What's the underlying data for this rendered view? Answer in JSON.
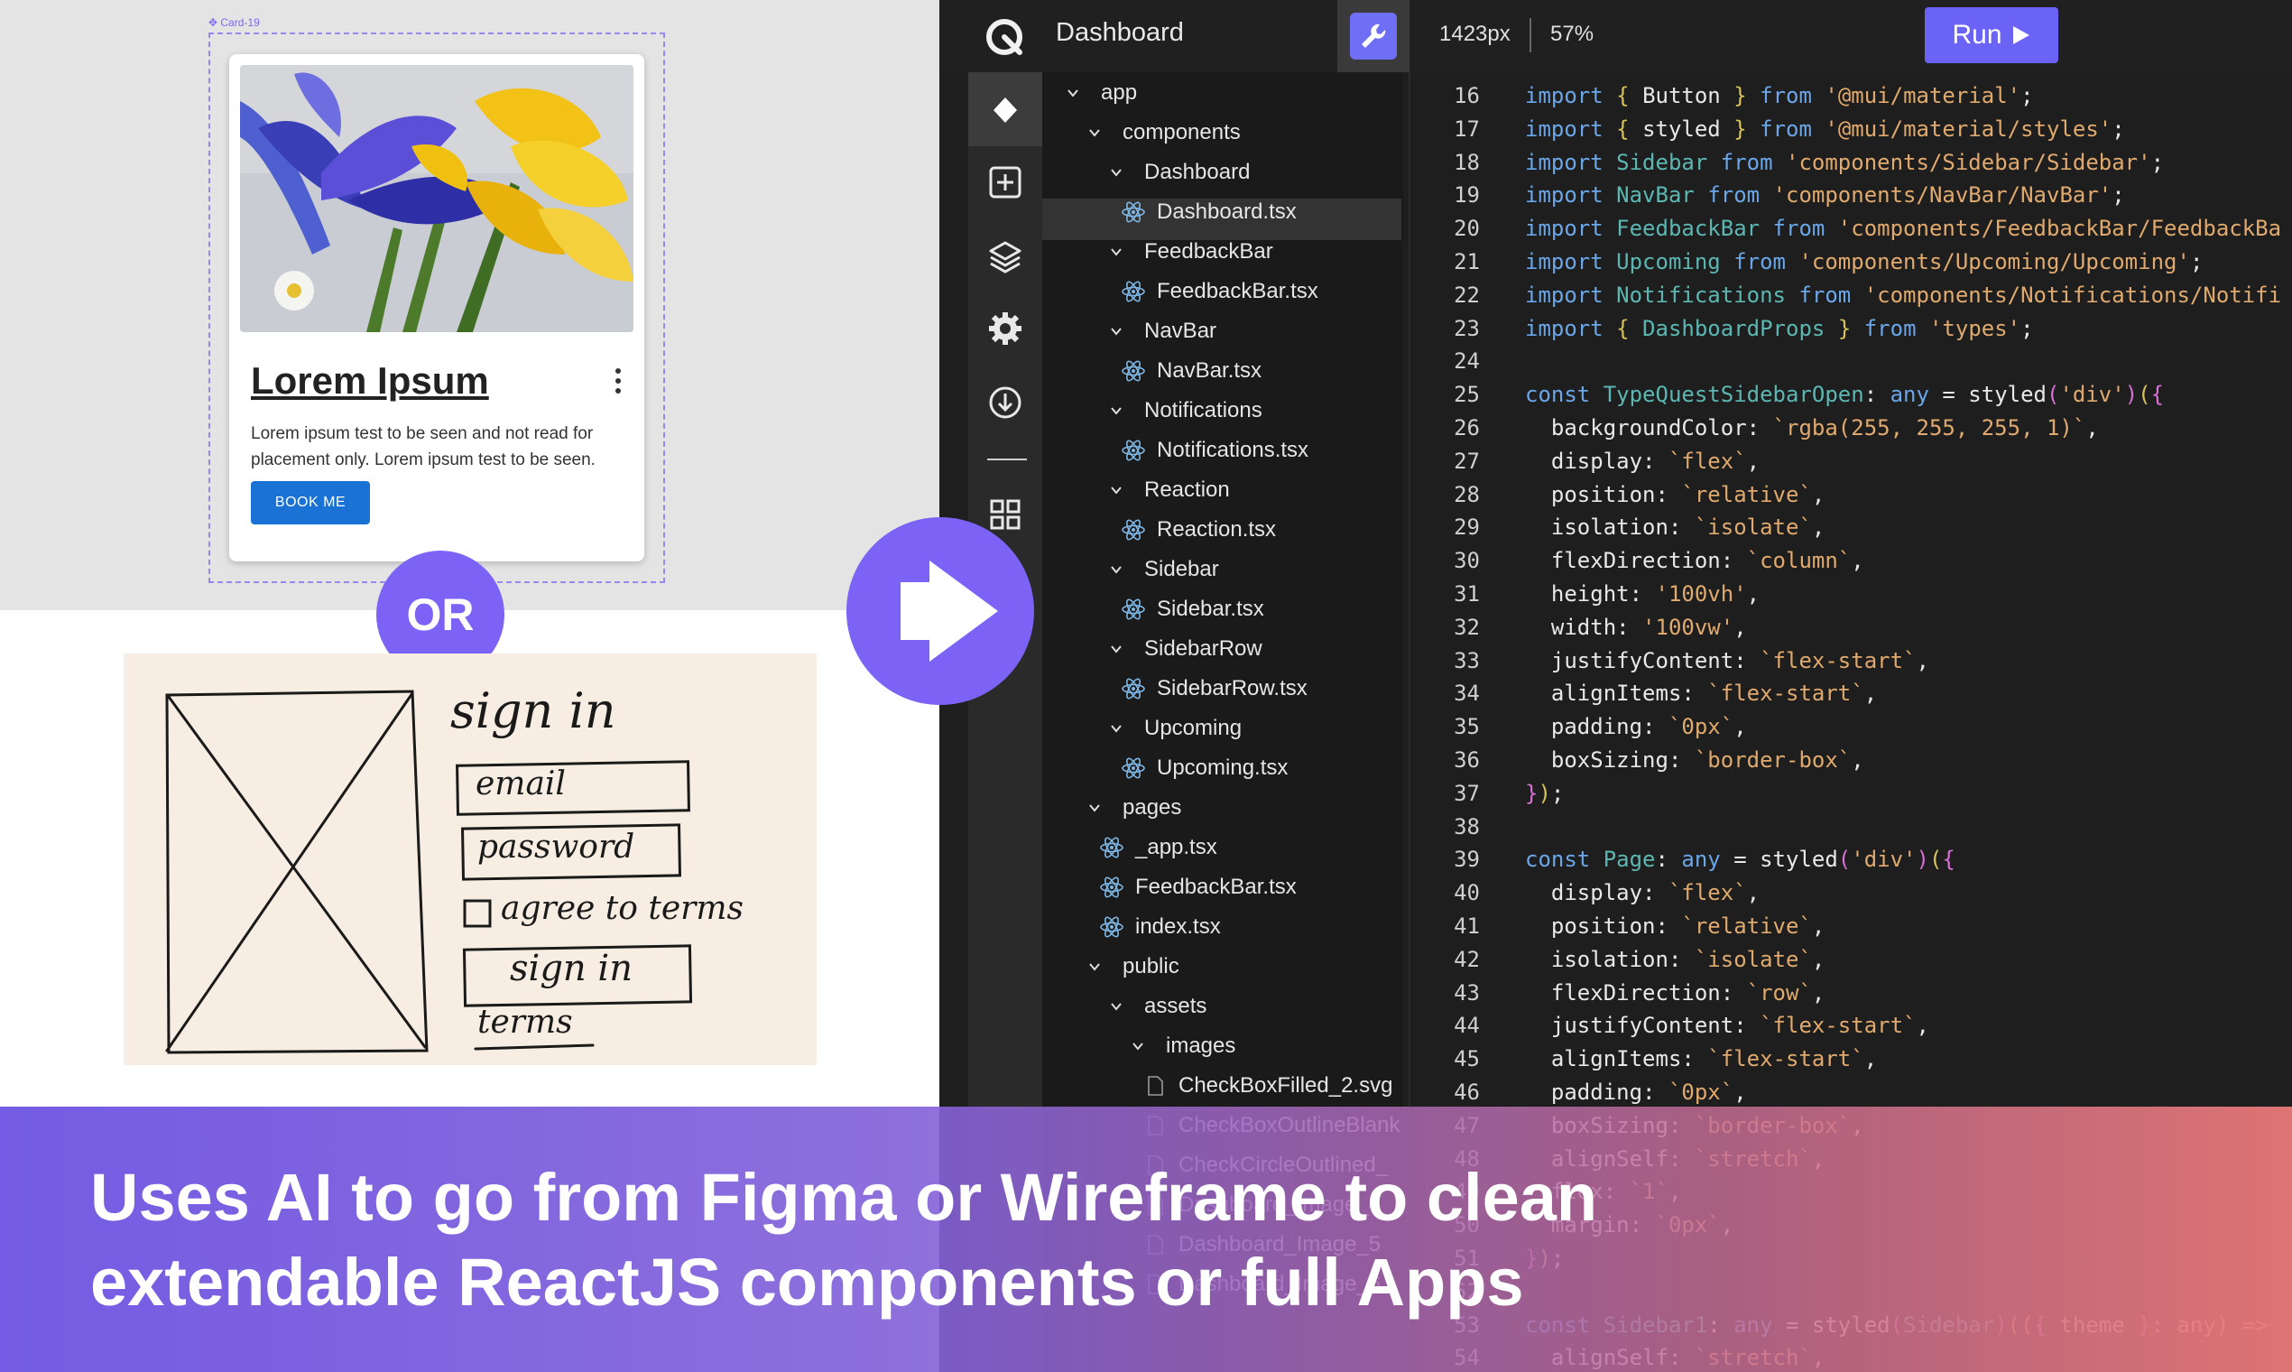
{
  "left": {
    "card_frame_label": "Card-19",
    "card": {
      "title": "Lorem Ipsum",
      "body": "Lorem ipsum test to be seen and not read for placement only. Lorem ipsum test to be seen.",
      "button_label": "BOOK ME"
    },
    "or_label": "OR",
    "wireframe": {
      "title": "sign in",
      "email_label": "email",
      "password_label": "password",
      "agree_label": "agree to terms",
      "sign_in_button": "sign in",
      "terms_link": "terms"
    }
  },
  "topbar": {
    "title": "Dashboard",
    "width_readout": "1423px",
    "zoom_readout": "57%",
    "run_label": "Run"
  },
  "tree": [
    {
      "label": "app",
      "kind": "folder",
      "depth": 0
    },
    {
      "label": "components",
      "kind": "folder",
      "depth": 1
    },
    {
      "label": "Dashboard",
      "kind": "folder",
      "depth": 2
    },
    {
      "label": "Dashboard.tsx",
      "kind": "file",
      "depth": 3,
      "selected": true
    },
    {
      "label": "FeedbackBar",
      "kind": "folder",
      "depth": 2
    },
    {
      "label": "FeedbackBar.tsx",
      "kind": "file",
      "depth": 3
    },
    {
      "label": "NavBar",
      "kind": "folder",
      "depth": 2
    },
    {
      "label": "NavBar.tsx",
      "kind": "file",
      "depth": 3
    },
    {
      "label": "Notifications",
      "kind": "folder",
      "depth": 2
    },
    {
      "label": "Notifications.tsx",
      "kind": "file",
      "depth": 3
    },
    {
      "label": "Reaction",
      "kind": "folder",
      "depth": 2
    },
    {
      "label": "Reaction.tsx",
      "kind": "file",
      "depth": 3
    },
    {
      "label": "Sidebar",
      "kind": "folder",
      "depth": 2
    },
    {
      "label": "Sidebar.tsx",
      "kind": "file",
      "depth": 3
    },
    {
      "label": "SidebarRow",
      "kind": "folder",
      "depth": 2
    },
    {
      "label": "SidebarRow.tsx",
      "kind": "file",
      "depth": 3
    },
    {
      "label": "Upcoming",
      "kind": "folder",
      "depth": 2
    },
    {
      "label": "Upcoming.tsx",
      "kind": "file",
      "depth": 3
    },
    {
      "label": "pages",
      "kind": "folder",
      "depth": 1
    },
    {
      "label": "_app.tsx",
      "kind": "file",
      "depth": 2
    },
    {
      "label": "FeedbackBar.tsx",
      "kind": "file",
      "depth": 2
    },
    {
      "label": "index.tsx",
      "kind": "file",
      "depth": 2
    },
    {
      "label": "public",
      "kind": "folder",
      "depth": 1
    },
    {
      "label": "assets",
      "kind": "folder",
      "depth": 2
    },
    {
      "label": "images",
      "kind": "folder",
      "depth": 3
    },
    {
      "label": "CheckBoxFilled_2.svg",
      "kind": "img",
      "depth": 4
    },
    {
      "label": "CheckBoxOutlineBlank",
      "kind": "img",
      "depth": 4
    },
    {
      "label": "CheckCircleOutlined_",
      "kind": "img",
      "depth": 4
    },
    {
      "label": "Dashboard_Image_4",
      "kind": "img",
      "depth": 4
    },
    {
      "label": "Dashboard_Image_5",
      "kind": "img",
      "depth": 4
    },
    {
      "label": "Dashboard_Image_6",
      "kind": "img",
      "depth": 4
    }
  ],
  "code": [
    {
      "n": "16",
      "t": [
        [
          "kw",
          "import "
        ],
        [
          "br",
          "{ "
        ],
        [
          "",
          "Button "
        ],
        [
          "br",
          "} "
        ],
        [
          "kw",
          "from "
        ],
        [
          "str",
          "'@mui/material'"
        ],
        [
          "",
          ";"
        ]
      ]
    },
    {
      "n": "17",
      "t": [
        [
          "kw",
          "import "
        ],
        [
          "br",
          "{ "
        ],
        [
          "",
          "styled "
        ],
        [
          "br",
          "} "
        ],
        [
          "kw",
          "from "
        ],
        [
          "str",
          "'@mui/material/styles'"
        ],
        [
          "",
          ";"
        ]
      ]
    },
    {
      "n": "18",
      "t": [
        [
          "kw",
          "import "
        ],
        [
          "ty",
          "Sidebar "
        ],
        [
          "kw",
          "from "
        ],
        [
          "str",
          "'components/Sidebar/Sidebar'"
        ],
        [
          "",
          ";"
        ]
      ]
    },
    {
      "n": "19",
      "t": [
        [
          "kw",
          "import "
        ],
        [
          "ty",
          "NavBar "
        ],
        [
          "kw",
          "from "
        ],
        [
          "str",
          "'components/NavBar/NavBar'"
        ],
        [
          "",
          ";"
        ]
      ]
    },
    {
      "n": "20",
      "t": [
        [
          "kw",
          "import "
        ],
        [
          "ty",
          "FeedbackBar "
        ],
        [
          "kw",
          "from "
        ],
        [
          "str",
          "'components/FeedbackBar/FeedbackBa"
        ]
      ]
    },
    {
      "n": "21",
      "t": [
        [
          "kw",
          "import "
        ],
        [
          "ty",
          "Upcoming "
        ],
        [
          "kw",
          "from "
        ],
        [
          "str",
          "'components/Upcoming/Upcoming'"
        ],
        [
          "",
          ";"
        ]
      ]
    },
    {
      "n": "22",
      "t": [
        [
          "kw",
          "import "
        ],
        [
          "ty",
          "Notifications "
        ],
        [
          "kw",
          "from "
        ],
        [
          "str",
          "'components/Notifications/Notifi"
        ]
      ]
    },
    {
      "n": "23",
      "t": [
        [
          "kw",
          "import "
        ],
        [
          "br",
          "{ "
        ],
        [
          "ty",
          "DashboardProps "
        ],
        [
          "br",
          "} "
        ],
        [
          "kw",
          "from "
        ],
        [
          "str",
          "'types'"
        ],
        [
          "",
          ";"
        ]
      ]
    },
    {
      "n": "24",
      "t": []
    },
    {
      "n": "25",
      "t": [
        [
          "kw",
          "const "
        ],
        [
          "ty",
          "TypeQuestSidebarOpen"
        ],
        [
          "",
          ": "
        ],
        [
          "kw",
          "any "
        ],
        [
          "",
          "= styled"
        ],
        [
          "br2",
          "("
        ],
        [
          "str",
          "'div'"
        ],
        [
          "br2",
          ")"
        ],
        [
          "br",
          "("
        ],
        [
          "br2",
          "{"
        ]
      ]
    },
    {
      "n": "26",
      "t": [
        [
          "",
          "  backgroundColor: "
        ],
        [
          "str",
          "`rgba(255, 255, 255, 1)`"
        ],
        [
          "",
          ","
        ]
      ]
    },
    {
      "n": "27",
      "t": [
        [
          "",
          "  display: "
        ],
        [
          "str",
          "`flex`"
        ],
        [
          "",
          ","
        ]
      ]
    },
    {
      "n": "28",
      "t": [
        [
          "",
          "  position: "
        ],
        [
          "str",
          "`relative`"
        ],
        [
          "",
          ","
        ]
      ]
    },
    {
      "n": "29",
      "t": [
        [
          "",
          "  isolation: "
        ],
        [
          "str",
          "`isolate`"
        ],
        [
          "",
          ","
        ]
      ]
    },
    {
      "n": "30",
      "t": [
        [
          "",
          "  flexDirection: "
        ],
        [
          "str",
          "`column`"
        ],
        [
          "",
          ","
        ]
      ]
    },
    {
      "n": "31",
      "t": [
        [
          "",
          "  height: "
        ],
        [
          "str",
          "'100vh'"
        ],
        [
          "",
          ","
        ]
      ]
    },
    {
      "n": "32",
      "t": [
        [
          "",
          "  width: "
        ],
        [
          "str",
          "'100vw'"
        ],
        [
          "",
          ","
        ]
      ]
    },
    {
      "n": "33",
      "t": [
        [
          "",
          "  justifyContent: "
        ],
        [
          "str",
          "`flex-start`"
        ],
        [
          "",
          ","
        ]
      ]
    },
    {
      "n": "34",
      "t": [
        [
          "",
          "  alignItems: "
        ],
        [
          "str",
          "`flex-start`"
        ],
        [
          "",
          ","
        ]
      ]
    },
    {
      "n": "35",
      "t": [
        [
          "",
          "  padding: "
        ],
        [
          "str",
          "`0px`"
        ],
        [
          "",
          ","
        ]
      ]
    },
    {
      "n": "36",
      "t": [
        [
          "",
          "  boxSizing: "
        ],
        [
          "str",
          "`border-box`"
        ],
        [
          "",
          ","
        ]
      ]
    },
    {
      "n": "37",
      "t": [
        [
          "br2",
          "}"
        ],
        [
          "br",
          ")"
        ],
        [
          "",
          ";"
        ]
      ]
    },
    {
      "n": "38",
      "t": []
    },
    {
      "n": "39",
      "t": [
        [
          "kw",
          "const "
        ],
        [
          "ty",
          "Page"
        ],
        [
          "",
          ": "
        ],
        [
          "kw",
          "any "
        ],
        [
          "",
          "= styled"
        ],
        [
          "br2",
          "("
        ],
        [
          "str",
          "'div'"
        ],
        [
          "br2",
          ")"
        ],
        [
          "br",
          "("
        ],
        [
          "br2",
          "{"
        ]
      ]
    },
    {
      "n": "40",
      "t": [
        [
          "",
          "  display: "
        ],
        [
          "str",
          "`flex`"
        ],
        [
          "",
          ","
        ]
      ]
    },
    {
      "n": "41",
      "t": [
        [
          "",
          "  position: "
        ],
        [
          "str",
          "`relative`"
        ],
        [
          "",
          ","
        ]
      ]
    },
    {
      "n": "42",
      "t": [
        [
          "",
          "  isolation: "
        ],
        [
          "str",
          "`isolate`"
        ],
        [
          "",
          ","
        ]
      ]
    },
    {
      "n": "43",
      "t": [
        [
          "",
          "  flexDirection: "
        ],
        [
          "str",
          "`row`"
        ],
        [
          "",
          ","
        ]
      ]
    },
    {
      "n": "44",
      "t": [
        [
          "",
          "  justifyContent: "
        ],
        [
          "str",
          "`flex-start`"
        ],
        [
          "",
          ","
        ]
      ]
    },
    {
      "n": "45",
      "t": [
        [
          "",
          "  alignItems: "
        ],
        [
          "str",
          "`flex-start`"
        ],
        [
          "",
          ","
        ]
      ]
    },
    {
      "n": "46",
      "t": [
        [
          "",
          "  padding: "
        ],
        [
          "str",
          "`0px`"
        ],
        [
          "",
          ","
        ]
      ]
    },
    {
      "n": "47",
      "t": [
        [
          "",
          "  boxSizing: "
        ],
        [
          "str",
          "`border-box`"
        ],
        [
          "",
          ","
        ]
      ]
    },
    {
      "n": "48",
      "t": [
        [
          "",
          "  alignSelf: "
        ],
        [
          "str",
          "`stretch`"
        ],
        [
          "",
          ","
        ]
      ]
    },
    {
      "n": "49",
      "t": [
        [
          "",
          "  flex: "
        ],
        [
          "str",
          "`1`"
        ],
        [
          "",
          ","
        ]
      ]
    },
    {
      "n": "50",
      "t": [
        [
          "",
          "  margin: "
        ],
        [
          "str",
          "`0px`"
        ],
        [
          "",
          ","
        ]
      ]
    },
    {
      "n": "51",
      "t": [
        [
          "br2",
          "}"
        ],
        [
          "br",
          ")"
        ],
        [
          "",
          ";"
        ]
      ]
    },
    {
      "n": "52",
      "t": []
    },
    {
      "n": "53",
      "t": [
        [
          "kw",
          "const "
        ],
        [
          "ty",
          "Sidebar1"
        ],
        [
          "",
          ": "
        ],
        [
          "kw",
          "any "
        ],
        [
          "",
          "= styled"
        ],
        [
          "br2",
          "("
        ],
        [
          "ty",
          "Sidebar"
        ],
        [
          "br2",
          ")"
        ],
        [
          "br",
          "(("
        ],
        [
          "br2",
          "{ "
        ],
        [
          "",
          "theme "
        ],
        [
          "br2",
          "}"
        ],
        [
          "",
          ": any) =>"
        ]
      ]
    },
    {
      "n": "54",
      "t": [
        [
          "",
          "  alignSelf: "
        ],
        [
          "str",
          "`stretch`"
        ],
        [
          "",
          ","
        ]
      ]
    }
  ],
  "banner": {
    "line1": "Uses AI to go from Figma or Wireframe to clean",
    "line2": "extendable ReactJS components or full Apps"
  },
  "colors": {
    "accent": "#7d63f5",
    "run_button": "#6b63f5",
    "book_button": "#1a73d4"
  },
  "icons": [
    "logo-icon",
    "wrench-icon",
    "play-icon",
    "select-tool-icon",
    "add-icon",
    "layers-icon",
    "gear-icon",
    "download-icon",
    "grid-icon",
    "react-file-icon",
    "image-file-icon",
    "chevron-down-icon",
    "more-vert-icon"
  ]
}
